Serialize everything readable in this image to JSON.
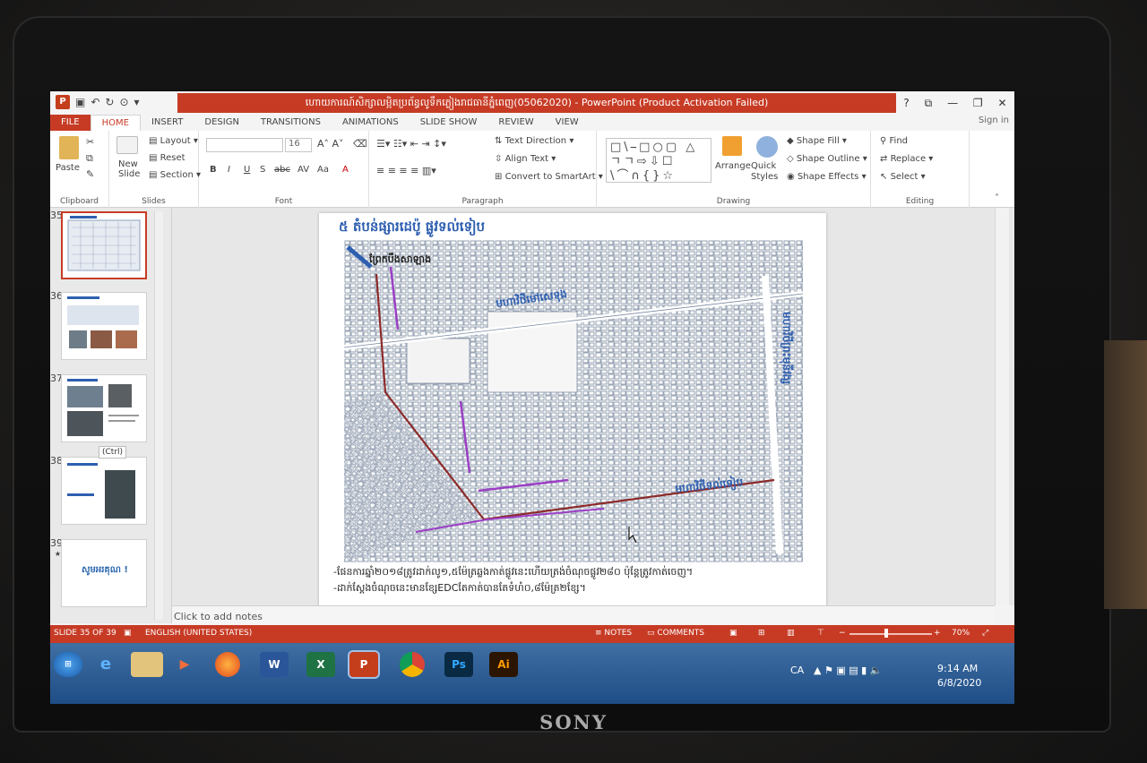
{
  "window": {
    "title": "ហោយការណ៍សិក្សាលម្អិតប្រព័ន្ធលូទឹកភ្លៀងរាជធានីភ្នំពេញ(05062020) - PowerPoint (Product Activation Failed)",
    "controls": [
      "?",
      "⧉",
      "—",
      "❐",
      "✕"
    ]
  },
  "ribbon": {
    "tabs": [
      "FILE",
      "HOME",
      "INSERT",
      "DESIGN",
      "TRANSITIONS",
      "ANIMATIONS",
      "SLIDE SHOW",
      "REVIEW",
      "VIEW"
    ],
    "active_tab": "HOME",
    "signin": "Sign in",
    "groups": {
      "clipboard": {
        "label": "Clipboard",
        "paste": "Paste"
      },
      "slides": {
        "label": "Slides",
        "new_slide": "New Slide",
        "layout": "Layout",
        "reset": "Reset",
        "section": "Section"
      },
      "font": {
        "label": "Font",
        "size": "16",
        "buttons": [
          "B",
          "I",
          "U",
          "S",
          "abc",
          "AV",
          "Aa",
          "A"
        ]
      },
      "paragraph": {
        "label": "Paragraph",
        "text_direction": "Text Direction",
        "align_text": "Align Text",
        "convert": "Convert to SmartArt"
      },
      "drawing": {
        "label": "Drawing",
        "arrange": "Arrange",
        "quick_styles": "Quick Styles",
        "shape_fill": "Shape Fill",
        "shape_outline": "Shape Outline",
        "shape_effects": "Shape Effects",
        "shapes_glyphs": "□\\⎯□○▢ △ㄱㄱ⇨⇩☐ \\⌒∩{}☆"
      },
      "editing": {
        "label": "Editing",
        "find": "Find",
        "replace": "Replace",
        "select": "Select"
      }
    }
  },
  "thumbnails": [
    {
      "num": "35",
      "selected": true
    },
    {
      "num": "36"
    },
    {
      "num": "37"
    },
    {
      "num": "38",
      "chip": "(Ctrl)"
    },
    {
      "num": "39",
      "star": "★",
      "text": "សូមអរគុណ !"
    }
  ],
  "slide": {
    "title": "៥ តំបន់ផ្សារដេប៉ូ ផ្លូវទល់ទៀប",
    "map_labels": {
      "top_left": "ព្រែកបឹងសាឡាង",
      "middle": "មហាវិថីម៉ៅសេទុង",
      "right_vertical": "មហាវិថីព្រះមុនីវង្ស",
      "bottom": "មហាវិថីទល់ទៀប"
    },
    "bullets": [
      "-ផែនការឆ្នាំ២០១៨ត្រូវដាក់លូ១,៥ម៉ែត្រឆ្លងកាត់ផ្លូវនេះហើយត្រង់ចំណុចផ្លូវ២៨០ ប៉ុន្តែត្រូវកាត់ចេញ។",
      "-ដាក់ស្ដែងចំណុចនេះមានខ្សែEDCតែកាត់បានតែទំហំ០,៨ម៉ែត្រ២ខ្សែ។"
    ]
  },
  "notes": {
    "placeholder": "Click to add notes"
  },
  "statusbar": {
    "slide": "SLIDE 35 OF 39",
    "language": "ENGLISH (UNITED STATES)",
    "notes": "NOTES",
    "comments": "COMMENTS",
    "zoom": "70%",
    "zoom_level": 0.45
  },
  "taskbar": {
    "apps": [
      "Start",
      "IE",
      "Explorer",
      "Media",
      "Firefox",
      "W",
      "X",
      "P",
      "Chrome",
      "Ps",
      "Ai"
    ],
    "lang": "CA",
    "time": "9:14 AM",
    "date": "6/8/2020"
  },
  "laptop": {
    "brand": "SONY"
  },
  "colors": {
    "accent": "#c73b25",
    "map_blue": "#3a5fa8",
    "route_red": "#8c2a2a",
    "route_purple": "#9b3fc5"
  }
}
